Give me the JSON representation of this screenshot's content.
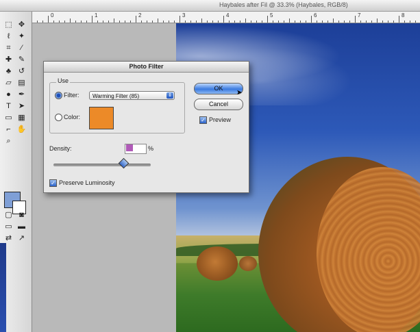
{
  "topbar": {
    "left_text": "",
    "right_text": "Haybales after Fil @ 33.3% (Haybales, RGB/8)"
  },
  "ruler": {
    "labels": [
      "0",
      "1",
      "2",
      "3",
      "4",
      "5",
      "6",
      "7",
      "8"
    ]
  },
  "toolbox": {
    "tools": [
      "marquee-tool-icon",
      "move-tool-icon",
      "lasso-tool-icon",
      "magic-wand-tool-icon",
      "crop-tool-icon",
      "slice-tool-icon",
      "healing-tool-icon",
      "brush-tool-icon",
      "stamp-tool-icon",
      "history-brush-tool-icon",
      "eraser-tool-icon",
      "gradient-tool-icon",
      "dodge-tool-icon",
      "pen-tool-icon",
      "type-tool-icon",
      "path-select-tool-icon",
      "shape-tool-icon",
      "notes-tool-icon",
      "eyedropper-tool-icon",
      "hand-tool-icon",
      "zoom-tool-icon"
    ],
    "foreground_color": "#7f9fd6",
    "background_color": "#ffffff"
  },
  "dialog": {
    "title": "Photo Filter",
    "use_label": "Use",
    "filter_label": "Filter:",
    "filter_value": "Warming Filter (85)",
    "color_label": "Color:",
    "color_swatch": "#ec8a28",
    "ok_label": "OK",
    "cancel_label": "Cancel",
    "preview_label": "Preview",
    "preview_checked": true,
    "density_label": "Density:",
    "density_value": "",
    "density_unit": "%",
    "density_slider_fraction": 0.72,
    "preserve_label": "Preserve Luminosity",
    "preserve_checked": true,
    "filter_selected": true
  }
}
